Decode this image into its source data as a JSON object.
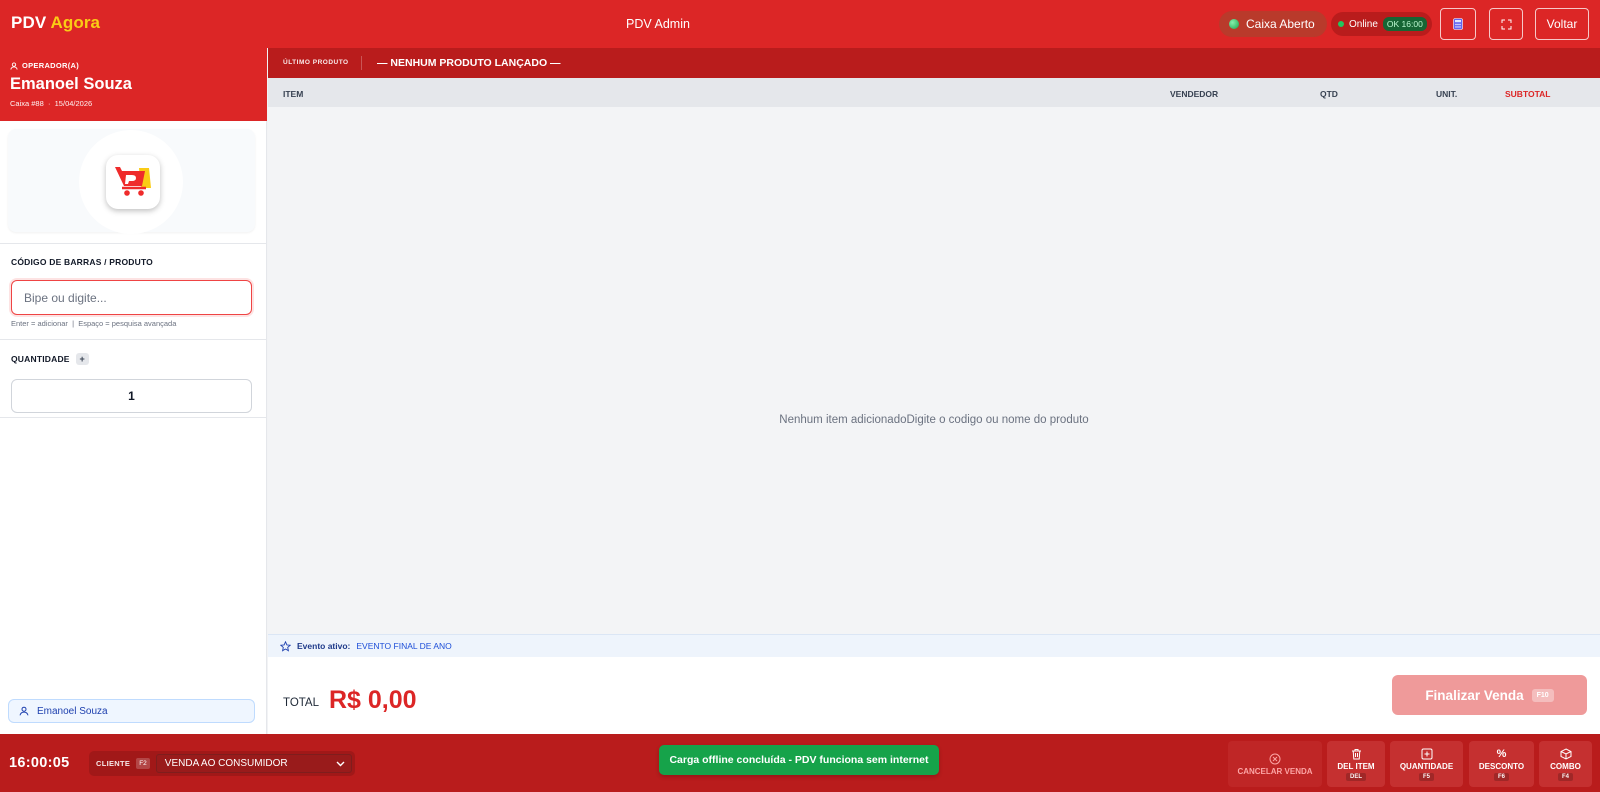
{
  "header": {
    "brand_main": "PDV",
    "brand_accent": "Agora",
    "title": "PDV Admin",
    "caixa_status": "Caixa Aberto",
    "online_label": "Online",
    "ok_badge": "OK 16:00",
    "back_label": "Voltar",
    "icons": [
      "calculator-icon",
      "fullscreen-icon"
    ]
  },
  "operator": {
    "label": "OPERADOR(A)",
    "name": "Emanoel Souza",
    "caixa": "Caixa #88",
    "date": "15/04/2026"
  },
  "search": {
    "label": "CÓDIGO DE BARRAS / PRODUTO",
    "placeholder": "Bipe ou digite...",
    "value": "",
    "hint": "Enter = adicionar  |  Espaço = pesquisa avançada"
  },
  "quantity": {
    "label": "QUANTIDADE",
    "plus": "+",
    "value": "1"
  },
  "seller": {
    "name": "Emanoel Souza"
  },
  "last_product": {
    "label": "ÚLTIMO PRODUTO",
    "value": "— NENHUM PRODUTO LANÇADO —"
  },
  "table": {
    "columns": [
      "ITEM",
      "VENDEDOR",
      "QTD",
      "UNIT.",
      "SUBTOTAL"
    ],
    "rows": [],
    "empty_message": "Nenhum item adicionadoDigite o codigo ou nome do produto"
  },
  "event": {
    "label": "Evento ativo:",
    "value": "EVENTO FINAL DE ANO"
  },
  "totals": {
    "label": "TOTAL",
    "value": "R$ 0,00",
    "finalize_label": "Finalizar Venda",
    "finalize_key": "F10"
  },
  "footer": {
    "clock": "16:00:05",
    "client_label": "CLIENTE",
    "client_key": "F2",
    "client_value": "VENDA AO CONSUMIDOR",
    "toast": "Carga offline concluída - PDV funciona sem internet",
    "actions": [
      {
        "label": "CANCELAR VENDA",
        "key": ""
      },
      {
        "label": "DEL ITEM",
        "key": "DEL"
      },
      {
        "label": "QUANTIDADE",
        "key": "F5"
      },
      {
        "label": "DESCONTO",
        "key": "F6"
      },
      {
        "label": "COMBO",
        "key": "F4"
      }
    ]
  },
  "colors": {
    "primary": "#dc2626",
    "dark": "#b91c1c",
    "success": "#16a34a",
    "accent": "#facc15"
  }
}
